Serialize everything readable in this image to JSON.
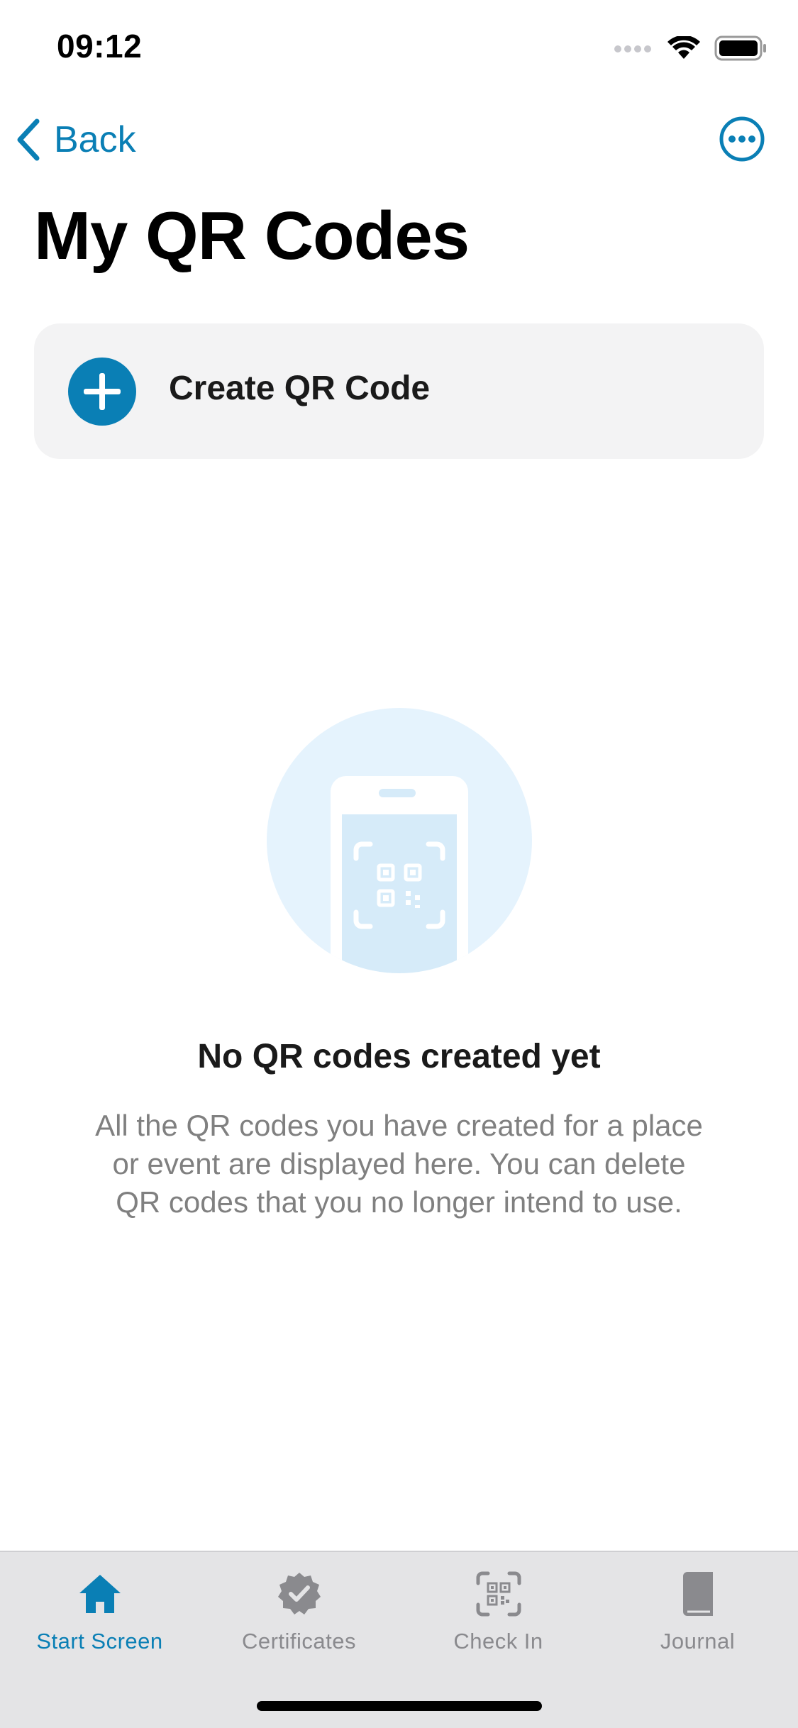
{
  "status_bar": {
    "time": "09:12"
  },
  "nav": {
    "back_label": "Back",
    "more_icon": "ellipsis-circle-icon"
  },
  "page": {
    "title": "My QR Codes"
  },
  "create_card": {
    "label": "Create QR Code",
    "icon": "plus-circle-icon"
  },
  "empty_state": {
    "title": "No QR codes created yet",
    "description": "All the QR codes you have created for a place or event are displayed here. You can delete QR codes that you no longer intend to use."
  },
  "tab_bar": {
    "items": [
      {
        "label": "Start Screen",
        "icon": "house-icon",
        "active": true
      },
      {
        "label": "Certificates",
        "icon": "certificate-check-icon",
        "active": false
      },
      {
        "label": "Check In",
        "icon": "qr-scan-icon",
        "active": false
      },
      {
        "label": "Journal",
        "icon": "book-icon",
        "active": false
      }
    ]
  },
  "colors": {
    "accent": "#0a7fb5",
    "card_background": "#f3f3f4",
    "tab_bar_background": "#e4e4e6",
    "secondary_text": "#808080",
    "inactive_tab": "#8a8a8e",
    "illustration_light": "#e5f3fd"
  }
}
